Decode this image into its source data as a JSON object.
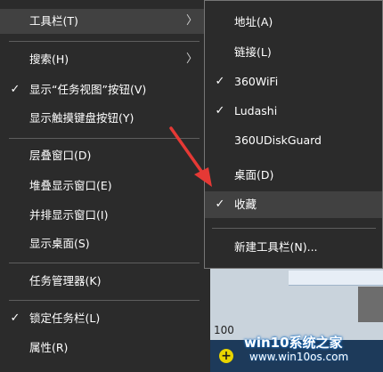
{
  "main_menu": {
    "items": [
      {
        "label": "工具栏(T)",
        "checked": false,
        "submenu": true,
        "hover": true
      },
      {
        "label": "搜索(H)",
        "checked": false,
        "submenu": true
      },
      {
        "label": "显示“任务视图”按钮(V)",
        "checked": true
      },
      {
        "label": "显示触摸键盘按钮(Y)",
        "checked": false
      },
      {
        "label": "层叠窗口(D)",
        "checked": false
      },
      {
        "label": "堆叠显示窗口(E)",
        "checked": false
      },
      {
        "label": "并排显示窗口(I)",
        "checked": false
      },
      {
        "label": "显示桌面(S)",
        "checked": false
      },
      {
        "label": "任务管理器(K)",
        "checked": false
      },
      {
        "label": "锁定任务栏(L)",
        "checked": true
      },
      {
        "label": "属性(R)",
        "checked": false
      }
    ]
  },
  "sub_menu": {
    "items": [
      {
        "label": "地址(A)",
        "checked": false
      },
      {
        "label": "链接(L)",
        "checked": false
      },
      {
        "label": "360WiFi",
        "checked": true
      },
      {
        "label": "Ludashi",
        "checked": true
      },
      {
        "label": "360UDiskGuard",
        "checked": false
      },
      {
        "label": "桌面(D)",
        "checked": false
      },
      {
        "label": "收藏",
        "checked": true,
        "hover": true
      },
      {
        "label": "新建工具栏(N)...",
        "checked": false
      }
    ]
  },
  "glyphs": {
    "check": "✓",
    "arrow": "〉",
    "plus": "+"
  },
  "background": {
    "number": "100"
  },
  "watermark": {
    "title": "win10系统之家",
    "url": "www.win10os.com"
  },
  "colors": {
    "menu_bg": "#2b2b2b",
    "hover_bg": "#414141",
    "separator": "#5e5e5e",
    "annotation_arrow": "#e53935"
  }
}
